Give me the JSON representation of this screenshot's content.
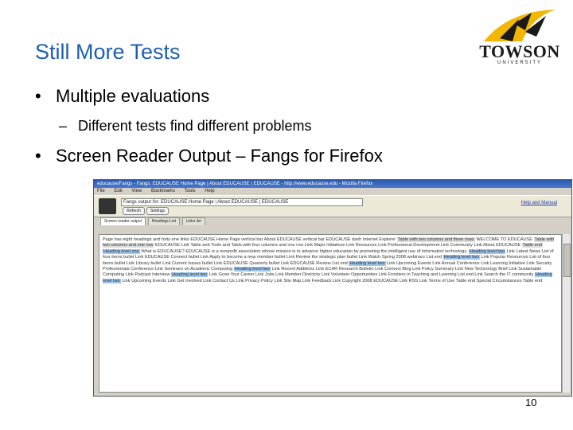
{
  "slide": {
    "title": "Still More Tests",
    "page_number": "10",
    "bullets": [
      {
        "marker": "•",
        "text": "Multiple evaluations"
      },
      {
        "marker": "–",
        "text": "Different tests find different problems"
      },
      {
        "marker": "•",
        "text": "Screen Reader Output – Fangs for Firefox"
      }
    ]
  },
  "logo": {
    "name": "TOWSON",
    "subtitle": "UNIVERSITY"
  },
  "screenshot": {
    "window_title": "educause/Fangs - Fangs: EDUCAUSE Home Page | About EDUCAUSE | EDUCAUSE - http://www.educause.edu - Mozilla Firefox",
    "menu": [
      "File",
      "Edit",
      "View",
      "Bookmarks",
      "Tools",
      "Help"
    ],
    "url_field": "Fangs output for: EDUCAUSE Home Page | About EDUCAUSE | EDUCAUSE",
    "buttons": [
      "Refresh",
      "Settings"
    ],
    "help_link": "Help and Manual",
    "tabs": [
      "Screen reader output",
      "Headings List",
      "Links list"
    ],
    "output": [
      {
        "t": "Page has eight headings and forty-one links EDUCAUSE Home Page vertical bar About EDUCAUSE vertical bar EDUCAUSE dash Internet Explorer "
      },
      {
        "t": "Table with two columns and three rows",
        "c": "lk"
      },
      {
        "t": " WELCOME TO EDUCAUSE "
      },
      {
        "t": "Table with two columns and one row",
        "c": "lk"
      },
      {
        "t": " EDUCAUSE Link Table and Tools and Table with four columns and one row Link Major Initiatives Link Resources Link Professional Development Link Community Link About EDUCAUSE "
      },
      {
        "t": "Table end",
        "c": "lk"
      },
      {
        "t": " "
      },
      {
        "t": "Heading level one",
        "c": "hl"
      },
      {
        "t": " What is EDUCAUSE? EDUCAUSE is a nonprofit association whose mission is to advance higher education by promoting the intelligent use of information technology. "
      },
      {
        "t": "Heading level two",
        "c": "hl"
      },
      {
        "t": " Link Latest News List of four items bullet Link EDUCAUSE Connect bullet Link Apply to become a new member bullet Link Review the strategic plan bullet Link Watch Spring 2008 webinars List end "
      },
      {
        "t": "Heading level two",
        "c": "hl"
      },
      {
        "t": " Link Popular Resources List of four items bullet Link Library bullet Link Current Issues bullet Link EDUCAUSE Quarterly bullet Link EDUCAUSE Review List end "
      },
      {
        "t": "Heading level two",
        "c": "hl"
      },
      {
        "t": " Link Upcoming Events Link Annual Conference Link Learning Initiative Link Security Professionals Conference Link Seminars on Academic Computing "
      },
      {
        "t": "Heading level two",
        "c": "hl"
      },
      {
        "t": " Link Recent Additions Link ECAR Research Bulletin Link Connect Blog Link Policy Summary Link New Technology Brief Link Sustainable Computing Link Podcast Interview "
      },
      {
        "t": "Heading level two",
        "c": "hl"
      },
      {
        "t": " Link Grow Your Career Link Jobs Link Member Directory Link Volunteer Opportunities Link Frontiers in Teaching and Learning List end Link Search the IT community "
      },
      {
        "t": "Heading level two",
        "c": "hl"
      },
      {
        "t": " Link Upcoming Events Link Get Involved Link Contact Us Link Privacy Policy Link Site Map Link Feedback Link Copyright 2008 EDUCAUSE Link RSS Link Terms of Use Table end Special Circumstances Table end"
      }
    ]
  }
}
